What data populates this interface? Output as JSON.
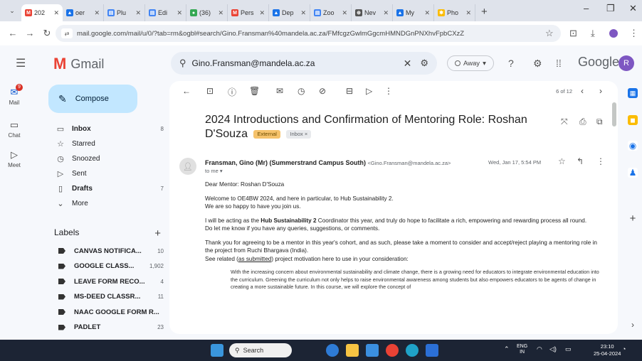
{
  "browser": {
    "tabs": [
      {
        "label": "202",
        "color": "#ea4335",
        "glyph": "M",
        "active": true
      },
      {
        "label": "oer",
        "color": "#1a73e8",
        "glyph": "▲",
        "active": false
      },
      {
        "label": "Plu",
        "color": "#4285f4",
        "glyph": "▤",
        "active": false
      },
      {
        "label": "Edi",
        "color": "#4285f4",
        "glyph": "▤",
        "active": false
      },
      {
        "label": "(36)",
        "color": "#34a853",
        "glyph": "●",
        "active": false
      },
      {
        "label": "Pers",
        "color": "#ea4335",
        "glyph": "M",
        "active": false
      },
      {
        "label": "Dep",
        "color": "#1a73e8",
        "glyph": "▲",
        "active": false
      },
      {
        "label": "Zoo",
        "color": "#4285f4",
        "glyph": "▤",
        "active": false
      },
      {
        "label": "Nev",
        "color": "#555555",
        "glyph": "⊕",
        "active": false
      },
      {
        "label": "My",
        "color": "#1a73e8",
        "glyph": "▲",
        "active": false
      },
      {
        "label": "Pho",
        "color": "#fbbc04",
        "glyph": "✱",
        "active": false
      }
    ],
    "new_tab": "+",
    "minimize": "–",
    "maximize": "❐",
    "close": "✕",
    "url": "mail.google.com/mail/u/0/?tab=rm&ogbl#search/Gino.Fransman%40mandela.ac.za/FMfcgzGwlmGgcmHMNDGnPNXhvFpbCXzZ"
  },
  "gmail": {
    "app_name": "Gmail",
    "search_value": "Gino.Fransman@mandela.ac.za",
    "status": "Away",
    "google_wordmark": "Google",
    "avatar_letter": "R",
    "rail": {
      "mail": "Mail",
      "mail_badge": "9",
      "chat": "Chat",
      "meet": "Meet"
    },
    "compose": "Compose",
    "nav": [
      {
        "icon": "▭",
        "label": "Inbox",
        "count": "8",
        "bold": true,
        "name": "nav-inbox"
      },
      {
        "icon": "☆",
        "label": "Starred",
        "count": "",
        "bold": false,
        "name": "nav-starred"
      },
      {
        "icon": "◷",
        "label": "Snoozed",
        "count": "",
        "bold": false,
        "name": "nav-snoozed"
      },
      {
        "icon": "▷",
        "label": "Sent",
        "count": "",
        "bold": false,
        "name": "nav-sent"
      },
      {
        "icon": "▯",
        "label": "Drafts",
        "count": "7",
        "bold": true,
        "name": "nav-drafts"
      },
      {
        "icon": "⌄",
        "label": "More",
        "count": "",
        "bold": false,
        "name": "nav-more"
      }
    ],
    "labels_title": "Labels",
    "labels": [
      {
        "label": "CANVAS NOTIFICA...",
        "count": "10"
      },
      {
        "label": "GOOGLE CLASS...",
        "count": "1,902"
      },
      {
        "label": "LEAVE FORM RECO...",
        "count": "4"
      },
      {
        "label": "MS-DEED CLASSR...",
        "count": "11"
      },
      {
        "label": "NAAC GOOGLE FORM R...",
        "count": ""
      },
      {
        "label": "PADLET",
        "count": "23"
      }
    ]
  },
  "email": {
    "pager": "6 of 12",
    "subject": "2024 Introductions and Confirmation of Mentoring Role: Roshan D'Souza",
    "chip_external": "External",
    "chip_inbox": "Inbox ×",
    "sender_name": "Fransman, Gino (Mr) (Summerstrand Campus South)",
    "sender_email": "<Gino.Fransman@mandela.ac.za>",
    "to": "to me ▾",
    "date": "Wed, Jan 17, 5:54 PM",
    "greeting": "Dear Mentor: Roshan D'Souza",
    "p1a": "Welcome to OE4BW 2024, and here in particular, to Hub Sustainability 2.",
    "p1b": "We are so happy to have you join us.",
    "p2_pre": "I will be acting as the ",
    "p2_bold": "Hub Sustainability 2",
    "p2_post": " Coordinator this year, and truly do hope to facilitate a rich, empowering and rewarding process all round.",
    "p2b": "Do let me know if you have any queries, suggestions, or comments.",
    "p3a": "Thank you for agreeing to be a mentor in this year's cohort, and as such, please take a moment to consider and accept/reject playing a mentoring role in the project from Ruchi Bhargava (India).",
    "p3b_pre": "See related (",
    "p3b_link": "as submitted",
    "p3b_post": ") project motivation here to use in your consideration:",
    "quote": "With the increasing concern about environmental sustainability and climate change, there is a growing need for educators to integrate environmental education into the curriculum. Greening the curriculum not only helps to raise environmental awareness among students but also empowers educators to be agents of change in creating a more sustainable future. In this course, we will explore the concept of"
  },
  "taskbar": {
    "search": "Search",
    "lang": "ENG",
    "region": "IN",
    "time": "23:10",
    "date": "25-04-2024"
  }
}
